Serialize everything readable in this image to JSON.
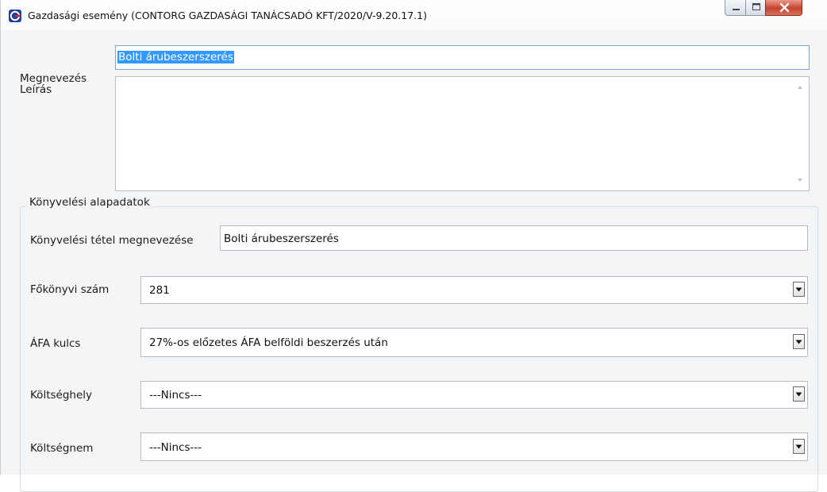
{
  "window": {
    "title": "Gazdasági esemény (CONTORG GAZDASÁGI TANÁCSADÓ KFT/2020/V-9.20.17.1)",
    "app_icon": "contorg-logo-icon",
    "controls": [
      "minimize-icon",
      "maximize-icon",
      "close-icon"
    ]
  },
  "form": {
    "name_label": "Megnevezés",
    "name_value": "Bolti árubeszerszerés",
    "description_label": "Leírás",
    "description_value": ""
  },
  "accounting": {
    "group_title": "Könyvelési alapadatok",
    "entry_name_label": "Könyvelési tétel megnevezése",
    "entry_name_value": "Bolti árubeszerszerés",
    "ledger_label": "Főkönyvi szám",
    "ledger_value": "281",
    "vat_label": "ÁFA kulcs",
    "vat_value": "27%-os előzetes ÁFA belföldi beszerzés után",
    "cost_center_label": "Költséghely",
    "cost_center_value": "---Nincs---",
    "cost_type_label": "Költségnem",
    "cost_type_value": "---Nincs---"
  },
  "colors": {
    "selection": "#3399ff",
    "close_button": "#c6442e",
    "app_icon": "#1f3f99"
  }
}
